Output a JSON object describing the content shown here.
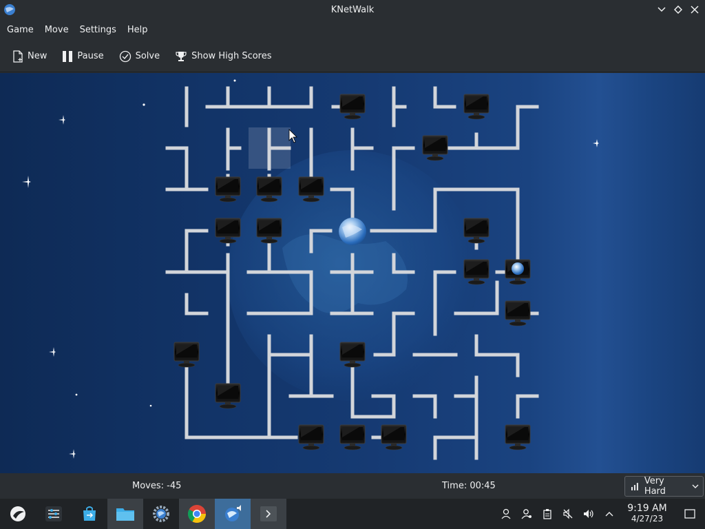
{
  "window": {
    "title": "KNetWalk"
  },
  "menu": {
    "items": [
      "Game",
      "Move",
      "Settings",
      "Help"
    ]
  },
  "toolbar": {
    "new_label": "New",
    "pause_label": "Pause",
    "solve_label": "Solve",
    "high_scores_label": "Show High Scores"
  },
  "status": {
    "moves": "Moves: -45",
    "time": "Time: 00:45",
    "difficulty": "Very Hard"
  },
  "taskbar": {
    "clock_time": "9:19 AM",
    "clock_date": "4/27/23",
    "apps": [
      "application-launcher-icon",
      "settings-sliders-icon",
      "store-icon",
      "file-manager-icon",
      "system-settings-icon",
      "chrome-icon",
      "knetwalk-icon",
      "terminal-icon"
    ]
  },
  "colors": {
    "pipe": "#c9ccd1",
    "window_bg": "#2a2e32",
    "taskbar_bg": "#202326",
    "accent": "#3d6d9b"
  }
}
